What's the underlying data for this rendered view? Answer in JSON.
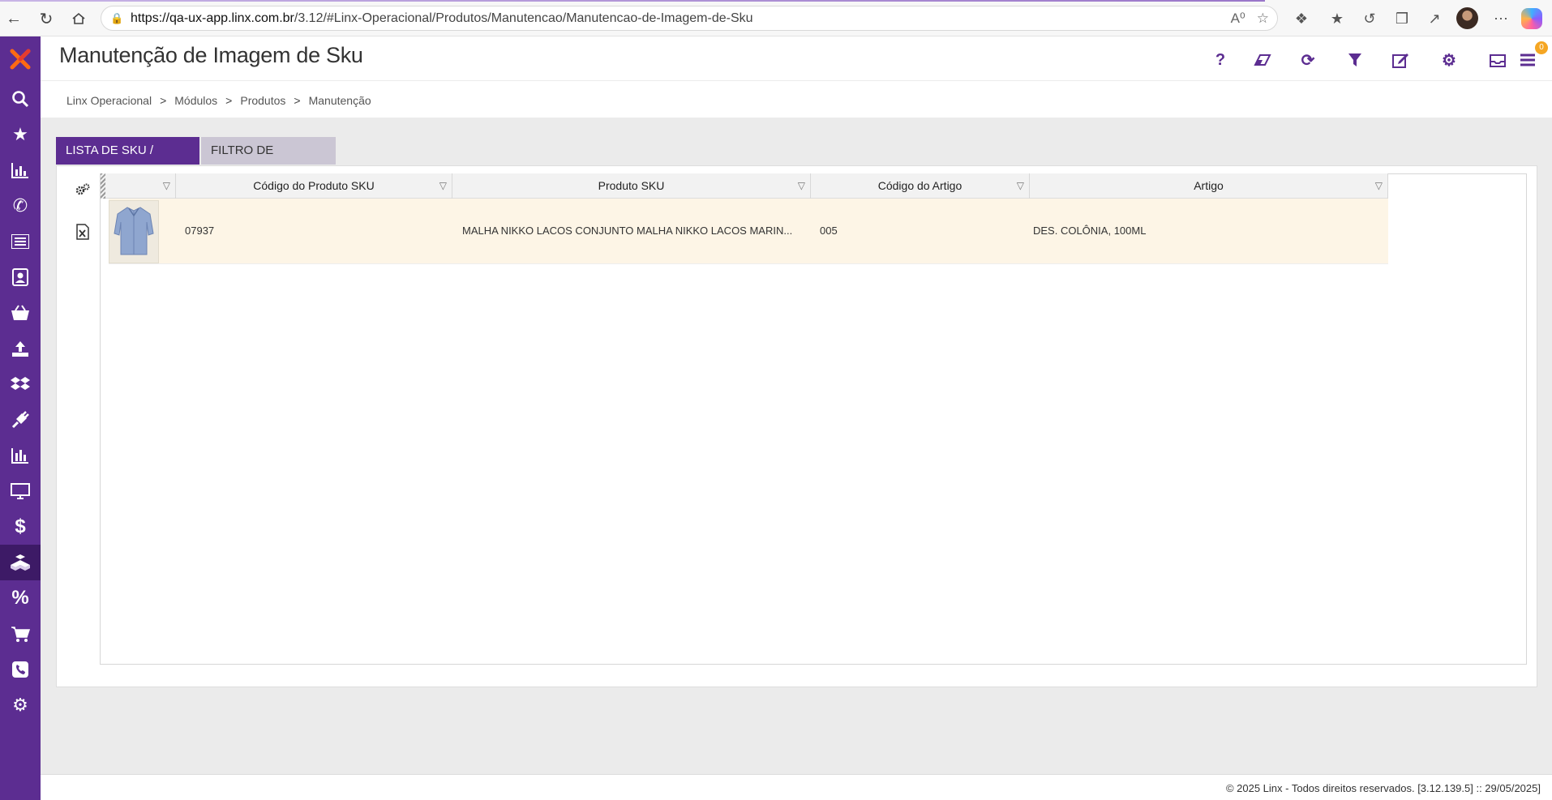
{
  "browser": {
    "url_host": "https://qa-ux-app.linx.com.br",
    "url_path": "/3.12/#Linx-Operacional/Produtos/Manutencao/Manutencao-de-Imagem-de-Sku"
  },
  "header": {
    "title": "Manutenção de Imagem de Sku",
    "mail_count": "0"
  },
  "breadcrumb": {
    "items": [
      "Linx Operacional",
      "Módulos",
      "Produtos",
      "Manutenção"
    ],
    "separator": ">"
  },
  "tabs": [
    {
      "label": "LISTA DE SKU / ARTIGO",
      "active": true
    },
    {
      "label": "FILTRO DE ATRIBUTO",
      "active": false
    }
  ],
  "grid": {
    "columns": [
      "Código do Produto SKU",
      "Produto SKU",
      "Código do Artigo",
      "Artigo"
    ],
    "rows": [
      {
        "codigo_sku": "07937",
        "produto_sku": "MALHA NIKKO LACOS CONJUNTO MALHA NIKKO LACOS MARIN...",
        "codigo_artigo": "005",
        "artigo": "DES. COLÔNIA, 100ML"
      }
    ]
  },
  "footer": {
    "text": "© 2025 Linx - Todos direitos reservados. [3.12.139.5] :: 29/05/2025]"
  },
  "colors": {
    "brand": "#5c2d91",
    "row_highlight": "#fdf5e6",
    "badge": "#f5a623"
  },
  "sidebar_icons": [
    "search-icon",
    "star-icon",
    "chart-icon",
    "phone-icon",
    "list-icon",
    "contacts-icon",
    "basket-icon",
    "upload-icon",
    "dropbox-icon",
    "plug-icon",
    "bar-chart-icon",
    "monitor-icon",
    "dollar-icon",
    "cubes-icon",
    "percent-icon",
    "cart-icon",
    "phone-square-icon",
    "cogs-icon"
  ]
}
